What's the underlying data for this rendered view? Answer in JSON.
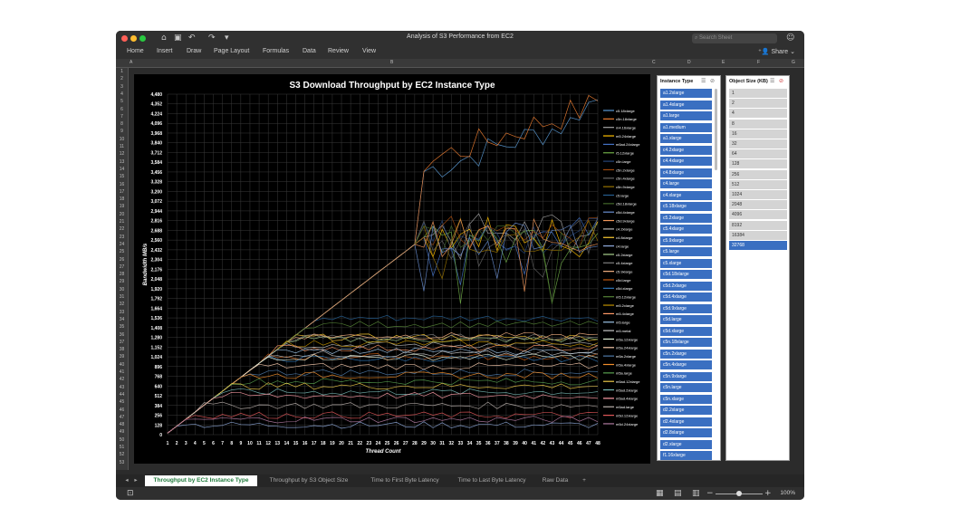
{
  "window": {
    "title": "Analysis of S3 Performance from EC2",
    "search_placeholder": "Search Sheet",
    "traffic_lights": [
      "#fe5f57",
      "#febc2e",
      "#28c840"
    ],
    "toolbar_icons": [
      "home-icon",
      "save-icon",
      "undo-icon",
      "redo-icon",
      "customize-icon"
    ]
  },
  "ribbon": {
    "tabs": [
      "Home",
      "Insert",
      "Draw",
      "Page Layout",
      "Formulas",
      "Data",
      "Review",
      "View"
    ],
    "share_label": "Share"
  },
  "columns": [
    "A",
    "B",
    "C",
    "D",
    "E",
    "F",
    "G"
  ],
  "rows": [
    "1",
    "2",
    "3",
    "4",
    "5",
    "6",
    "7",
    "8",
    "9",
    "10",
    "11",
    "12",
    "13",
    "14",
    "15",
    "16",
    "17",
    "18",
    "19",
    "20",
    "21",
    "22",
    "23",
    "24",
    "25",
    "26",
    "27",
    "28",
    "29",
    "30",
    "31",
    "32",
    "33",
    "34",
    "35",
    "36",
    "37",
    "38",
    "39",
    "40",
    "41",
    "42",
    "43",
    "44",
    "45",
    "46",
    "47",
    "48",
    "49",
    "50",
    "51",
    "52",
    "53"
  ],
  "chart_data": {
    "type": "line",
    "title": "S3 Download Throughput by EC2 Instance Type",
    "xlabel": "Thread Count",
    "ylabel": "Bandwidth MB/s",
    "x": [
      1,
      2,
      3,
      4,
      5,
      6,
      7,
      8,
      9,
      10,
      11,
      12,
      13,
      14,
      15,
      16,
      17,
      18,
      19,
      20,
      21,
      22,
      23,
      24,
      25,
      26,
      27,
      28,
      29,
      30,
      31,
      32,
      33,
      34,
      35,
      36,
      37,
      38,
      39,
      40,
      41,
      42,
      43,
      44,
      45,
      46,
      47,
      48
    ],
    "y_ticks": [
      0,
      128,
      256,
      384,
      512,
      640,
      768,
      896,
      1024,
      1152,
      1280,
      1408,
      1536,
      1664,
      1792,
      1920,
      2048,
      2176,
      2304,
      2432,
      2560,
      2688,
      2816,
      2944,
      3072,
      3200,
      3328,
      3456,
      3584,
      3712,
      3840,
      3968,
      4096,
      4224,
      4352,
      4480
    ],
    "y_tick_labels": [
      "0",
      "128",
      "256",
      "384",
      "512",
      "640",
      "768",
      "896",
      "1,024",
      "1,152",
      "1,280",
      "1,408",
      "1,536",
      "1,664",
      "1,792",
      "1,920",
      "2,048",
      "2,176",
      "2,304",
      "2,432",
      "2,560",
      "2,688",
      "2,816",
      "2,944",
      "3,072",
      "3,200",
      "3,328",
      "3,456",
      "3,584",
      "3,712",
      "3,840",
      "3,968",
      "4,096",
      "4,224",
      "4,352",
      "4,480"
    ],
    "ylim": [
      0,
      4480
    ],
    "grid": true,
    "legend_placement": "right",
    "series": [
      {
        "name": "c5.18xlarge",
        "color": "#5b9bd5",
        "peak": 4224,
        "plateau": 4224
      },
      {
        "name": "c5n.18xlarge",
        "color": "#ed7d31",
        "peak": 4350,
        "plateau": 4350
      },
      {
        "name": "m4.16xlarge",
        "color": "#a5a5a5",
        "peak": 2680,
        "plateau": 2680
      },
      {
        "name": "m5.24xlarge",
        "color": "#ffc000",
        "peak": 2680,
        "plateau": 2660
      },
      {
        "name": "m5ad.24xlarge",
        "color": "#4472c4",
        "peak": 2690,
        "plateau": 2650
      },
      {
        "name": "r5.12xlarge",
        "color": "#70ad47",
        "peak": 2650,
        "plateau": 2600
      },
      {
        "name": "c5n.large",
        "color": "#264478",
        "peak": 2660,
        "plateau": 2620
      },
      {
        "name": "c5n.2xlarge",
        "color": "#9e480e",
        "peak": 2640,
        "plateau": 2640
      },
      {
        "name": "c5n.4xlarge",
        "color": "#636363",
        "peak": 2630,
        "plateau": 2630
      },
      {
        "name": "c5n.9xlarge",
        "color": "#997300",
        "peak": 2620,
        "plateau": 2620
      },
      {
        "name": "c5.large",
        "color": "#255e91",
        "peak": 1536,
        "plateau": 1536
      },
      {
        "name": "c5d.18xlarge",
        "color": "#43682b",
        "peak": 2600,
        "plateau": 2600
      },
      {
        "name": "c5d.4xlarge",
        "color": "#698ed0",
        "peak": 2560,
        "plateau": 2560
      },
      {
        "name": "c5d.9xlarge",
        "color": "#f1975a",
        "peak": 2590,
        "plateau": 2590
      },
      {
        "name": "c4.2xlarge",
        "color": "#b7b7b7",
        "peak": 1180,
        "plateau": 1180
      },
      {
        "name": "c4.8xlarge",
        "color": "#ffcd33",
        "peak": 1280,
        "plateau": 1280
      },
      {
        "name": "c4.large",
        "color": "#8faadc",
        "peak": 128,
        "plateau": 128
      },
      {
        "name": "c5.2xlarge",
        "color": "#a9d18e",
        "peak": 1250,
        "plateau": 1250
      },
      {
        "name": "c5.4xlarge",
        "color": "#7f7f7f",
        "peak": 1280,
        "plateau": 1280
      },
      {
        "name": "c5.9xlarge",
        "color": "#f4b183",
        "peak": 1300,
        "plateau": 1300
      },
      {
        "name": "c5d.large",
        "color": "#c55a11",
        "peak": 1024,
        "plateau": 1024
      },
      {
        "name": "c5d.xlarge",
        "color": "#2e75b6",
        "peak": 1000,
        "plateau": 1000
      },
      {
        "name": "m5.12xlarge",
        "color": "#548235",
        "peak": 1450,
        "plateau": 1450
      },
      {
        "name": "m5.2xlarge",
        "color": "#bf9000",
        "peak": 1200,
        "plateau": 1200
      },
      {
        "name": "m5.4xlarge",
        "color": "#ff9966",
        "peak": 1140,
        "plateau": 1140
      },
      {
        "name": "m5.large",
        "color": "#9dc3e6",
        "peak": 1100,
        "plateau": 1100
      },
      {
        "name": "m5.metal",
        "color": "#c9c9c9",
        "peak": 1060,
        "plateau": 1060
      },
      {
        "name": "m5a.12xlarge",
        "color": "#e2f0d9",
        "peak": 1020,
        "plateau": 1020
      },
      {
        "name": "m5a.24xlarge",
        "color": "#f8cbad",
        "peak": 900,
        "plateau": 900
      },
      {
        "name": "m5a.2xlarge",
        "color": "#4e79a7",
        "peak": 820,
        "plateau": 820
      },
      {
        "name": "m5a.4xlarge",
        "color": "#f28e2b",
        "peak": 780,
        "plateau": 780
      },
      {
        "name": "m5a.large",
        "color": "#59a14f",
        "peak": 700,
        "plateau": 700
      },
      {
        "name": "m5ad.12xlarge",
        "color": "#edc948",
        "peak": 640,
        "plateau": 640
      },
      {
        "name": "m5ad.2xlarge",
        "color": "#76b7b2",
        "peak": 560,
        "plateau": 560
      },
      {
        "name": "m5ad.4xlarge",
        "color": "#ff9da7",
        "peak": 512,
        "plateau": 512
      },
      {
        "name": "m5ad.large",
        "color": "#bab0ac",
        "peak": 384,
        "plateau": 384
      },
      {
        "name": "m5d.12xlarge",
        "color": "#e15759",
        "peak": 256,
        "plateau": 256
      },
      {
        "name": "m5d.24xlarge",
        "color": "#b07aa1",
        "peak": 200,
        "plateau": 200
      }
    ]
  },
  "slicers": {
    "instance_type": {
      "title": "Instance Type",
      "items": [
        "a1.2xlarge",
        "a1.4xlarge",
        "a1.large",
        "a1.medium",
        "a1.xlarge",
        "c4.2xlarge",
        "c4.4xlarge",
        "c4.8xlarge",
        "c4.large",
        "c4.xlarge",
        "c5.18xlarge",
        "c5.2xlarge",
        "c5.4xlarge",
        "c5.9xlarge",
        "c5.large",
        "c5.xlarge",
        "c5d.18xlarge",
        "c5d.2xlarge",
        "c5d.4xlarge",
        "c5d.9xlarge",
        "c5d.large",
        "c5d.xlarge",
        "c5n.18xlarge",
        "c5n.2xlarge",
        "c5n.4xlarge",
        "c5n.9xlarge",
        "c5n.large",
        "c5n.xlarge",
        "d2.2xlarge",
        "d2.4xlarge",
        "d2.8xlarge",
        "d2.xlarge",
        "f1.16xlarge"
      ],
      "selected_color": "#3a6fc1"
    },
    "object_size": {
      "title": "Object Size (KB)",
      "items": [
        "1",
        "2",
        "4",
        "8",
        "16",
        "32",
        "64",
        "128",
        "256",
        "512",
        "1024",
        "2048",
        "4096",
        "8192",
        "16384",
        "32768"
      ],
      "selected": [
        "32768"
      ],
      "unselected_color": "#d4d4d4"
    }
  },
  "sheet_tabs": [
    {
      "label": "Throughput by EC2 Instance Type",
      "active": true
    },
    {
      "label": "Throughput by S3 Object Size",
      "active": false
    },
    {
      "label": "Time to First Byte Latency",
      "active": false
    },
    {
      "label": "Time to Last Byte Latency",
      "active": false
    },
    {
      "label": "Raw Data",
      "active": false
    }
  ],
  "status": {
    "zoom": "100%",
    "view_icons": [
      "normal-view-icon",
      "page-layout-view-icon",
      "page-break-view-icon"
    ]
  }
}
